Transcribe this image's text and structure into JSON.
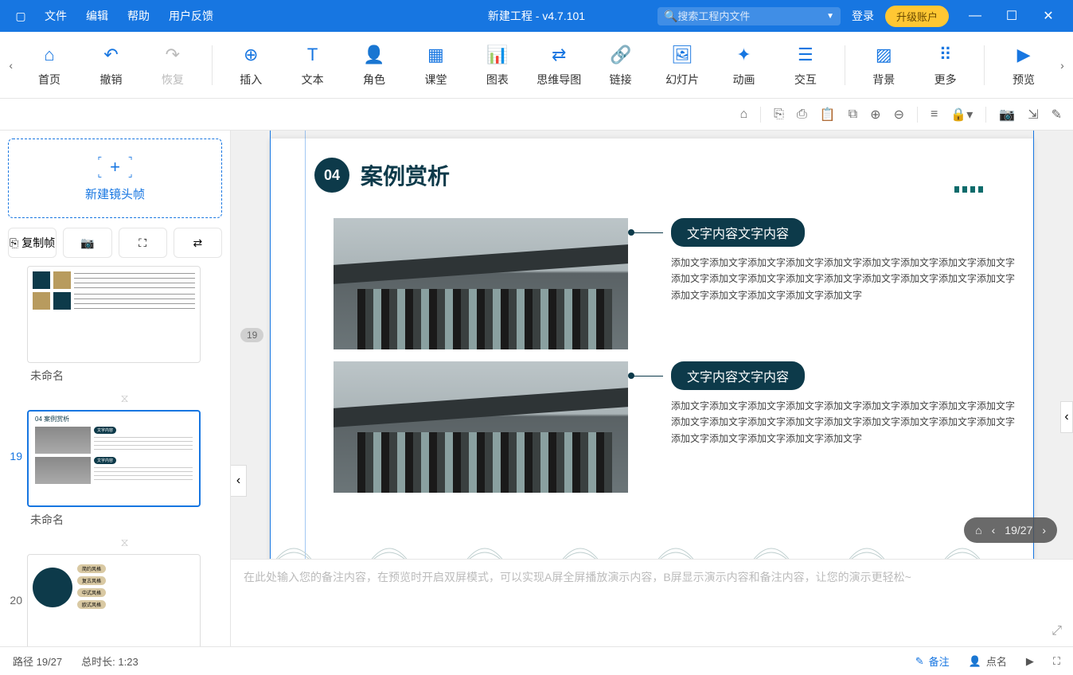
{
  "titlebar": {
    "menus": [
      "文件",
      "编辑",
      "帮助",
      "用户反馈"
    ],
    "doc_title": "新建工程 - v4.7.101",
    "search_placeholder": "搜索工程内文件",
    "login": "登录",
    "upgrade": "升级账户"
  },
  "toolbar": {
    "home": "首页",
    "undo": "撤销",
    "redo": "恢复",
    "insert": "插入",
    "text": "文本",
    "role": "角色",
    "class": "课堂",
    "chart": "图表",
    "mindmap": "思维导图",
    "link": "链接",
    "slideshow": "幻灯片",
    "animation": "动画",
    "interact": "交互",
    "background": "背景",
    "more": "更多",
    "preview": "预览"
  },
  "side": {
    "new_frame": "新建镜头帧",
    "copy_frame": "复制帧",
    "slides": [
      {
        "num": "",
        "name": "未命名"
      },
      {
        "num": "19",
        "name": "未命名"
      },
      {
        "num": "20",
        "name": ""
      }
    ]
  },
  "canvas": {
    "badge": "19",
    "section_num": "04",
    "section_title": "案例赏析",
    "blocks": [
      {
        "heading": "文字内容文字内容",
        "body": "添加文字添加文字添加文字添加文字添加文字添加文字添加文字添加文字添加文字添加文字添加文字添加文字添加文字添加文字添加文字添加文字添加文字添加文字添加文字添加文字添加文字添加文字添加文字"
      },
      {
        "heading": "文字内容文字内容",
        "body": "添加文字添加文字添加文字添加文字添加文字添加文字添加文字添加文字添加文字添加文字添加文字添加文字添加文字添加文字添加文字添加文字添加文字添加文字添加文字添加文字添加文字添加文字添加文字"
      }
    ]
  },
  "pagepill": {
    "counter": "19/27"
  },
  "notes": {
    "placeholder": "在此处输入您的备注内容，在预览时开启双屏模式，可以实现A屏全屏播放演示内容，B屏显示演示内容和备注内容，让您的演示更轻松~"
  },
  "status": {
    "path": "路径 19/27",
    "duration": "总时长: 1:23",
    "notes_btn": "备注",
    "naming_btn": "点名"
  }
}
